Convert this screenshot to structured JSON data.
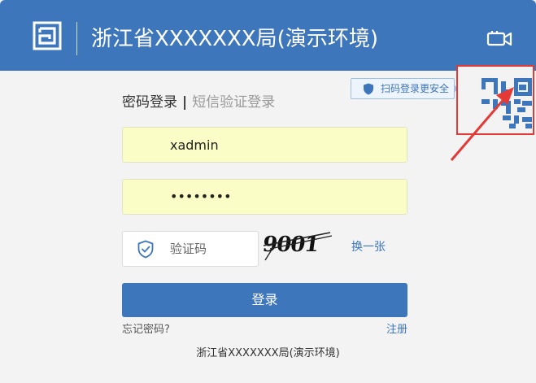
{
  "header": {
    "title": "浙江省XXXXXXX局(演示环境)",
    "logo_icon": "logo-icon",
    "camera_icon": "video-camera-icon"
  },
  "tabs": [
    {
      "label": "密码登录",
      "active": true
    },
    {
      "label": "短信验证登录",
      "active": false
    }
  ],
  "tab_separator": "|",
  "scan_badge": {
    "label": "扫码登录更安全",
    "icon": "shield-icon"
  },
  "qr": {
    "icon": "qr-code-icon"
  },
  "username": {
    "value": "xadmin"
  },
  "password": {
    "masked": "••••••••"
  },
  "captcha": {
    "placeholder": "验证码",
    "image_text": "9001",
    "refresh_label": "换一张"
  },
  "login_button": "登录",
  "forgot_label": "忘记密码?",
  "register_label": "注册",
  "footer": "浙江省XXXXXXX局(演示环境)",
  "colors": {
    "primary": "#3e76bc",
    "input_fill": "#fafdc5",
    "highlight": "#e53935"
  }
}
